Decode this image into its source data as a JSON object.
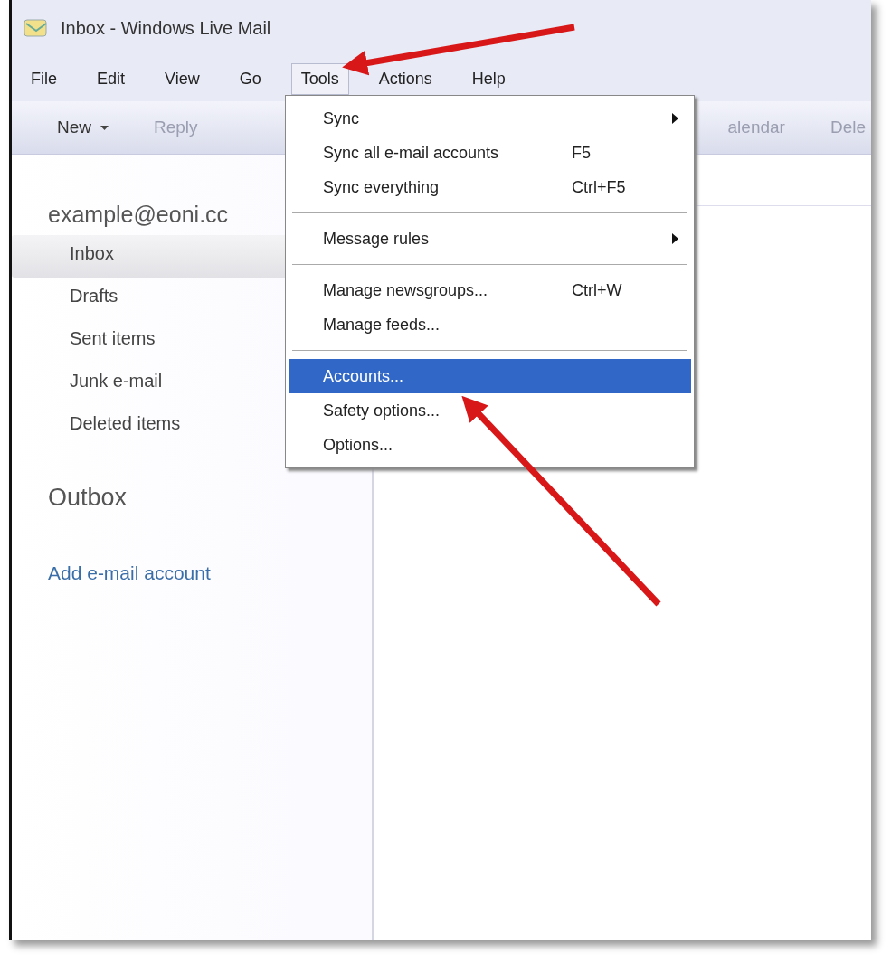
{
  "window": {
    "title": "Inbox - Windows Live Mail"
  },
  "menu_bar": [
    {
      "label": "File",
      "selected": false
    },
    {
      "label": "Edit",
      "selected": false
    },
    {
      "label": "View",
      "selected": false
    },
    {
      "label": "Go",
      "selected": false
    },
    {
      "label": "Tools",
      "selected": true
    },
    {
      "label": "Actions",
      "selected": false
    },
    {
      "label": "Help",
      "selected": false
    }
  ],
  "toolbar": [
    {
      "label": "New",
      "kind": "dropdown"
    },
    {
      "label": "Reply",
      "kind": "plain"
    },
    {
      "label": "alendar",
      "kind": "plain"
    },
    {
      "label": "Dele",
      "kind": "plain"
    }
  ],
  "sidebar": {
    "account": "example@eoni.cc",
    "folders": [
      {
        "label": "Inbox",
        "selected": true
      },
      {
        "label": "Drafts",
        "selected": false
      },
      {
        "label": "Sent items",
        "selected": false
      },
      {
        "label": "Junk e-mail",
        "selected": false
      },
      {
        "label": "Deleted items",
        "selected": false
      }
    ],
    "outbox": "Outbox",
    "add_account": "Add e-mail account"
  },
  "tools_menu": [
    {
      "kind": "item",
      "label": "Sync",
      "submenu": true,
      "selected": false
    },
    {
      "kind": "item",
      "label": "Sync all e-mail accounts",
      "shortcut": "F5",
      "submenu": false,
      "selected": false
    },
    {
      "kind": "item",
      "label": "Sync everything",
      "shortcut": "Ctrl+F5",
      "submenu": false,
      "selected": false
    },
    {
      "kind": "separator"
    },
    {
      "kind": "item",
      "label": "Message rules",
      "submenu": true,
      "selected": false
    },
    {
      "kind": "separator"
    },
    {
      "kind": "item",
      "label": "Manage newsgroups...",
      "shortcut": "Ctrl+W",
      "submenu": false,
      "selected": false
    },
    {
      "kind": "item",
      "label": "Manage feeds...",
      "submenu": false,
      "selected": false
    },
    {
      "kind": "separator"
    },
    {
      "kind": "item",
      "label": "Accounts...",
      "submenu": false,
      "selected": true
    },
    {
      "kind": "item",
      "label": "Safety options...",
      "submenu": false,
      "selected": false
    },
    {
      "kind": "item",
      "label": "Options...",
      "submenu": false,
      "selected": false
    }
  ]
}
